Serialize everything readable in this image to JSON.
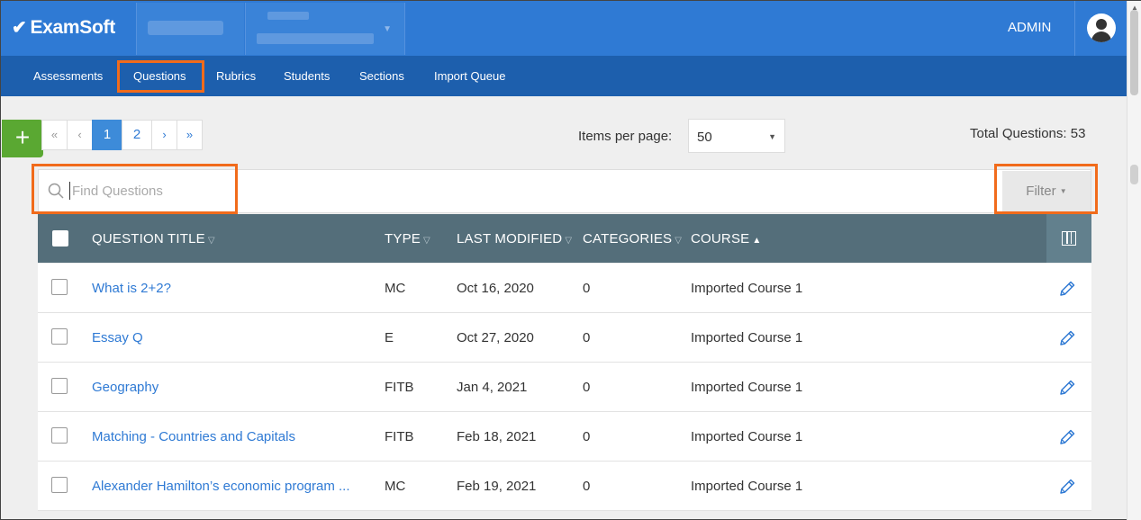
{
  "header": {
    "logo_text": "ExamSoft",
    "admin_label": "ADMIN"
  },
  "nav": {
    "items": [
      "Assessments",
      "Questions",
      "Rubrics",
      "Students",
      "Sections",
      "Import Queue"
    ],
    "active": "Questions"
  },
  "toolbar": {
    "add_label": "+",
    "pagination": {
      "first": "«",
      "prev": "‹",
      "pages": [
        "1",
        "2"
      ],
      "current": "1",
      "next": "›",
      "last": "»"
    },
    "items_per_page_label": "Items per page:",
    "items_per_page_value": "50",
    "total_label": "Total Questions: 53"
  },
  "search": {
    "placeholder": "Find Questions",
    "filter_label": "Filter"
  },
  "table": {
    "columns": [
      "QUESTION TITLE",
      "TYPE",
      "LAST MODIFIED",
      "CATEGORIES",
      "COURSE"
    ],
    "sort_column": "COURSE",
    "sort_direction": "ascending",
    "rows": [
      {
        "title": "What is 2+2?",
        "type": "MC",
        "modified": "Oct 16, 2020",
        "categories": "0",
        "course": "Imported Course 1"
      },
      {
        "title": "Essay Q",
        "type": "E",
        "modified": "Oct 27, 2020",
        "categories": "0",
        "course": "Imported Course 1"
      },
      {
        "title": "Geography",
        "type": "FITB",
        "modified": "Jan 4, 2021",
        "categories": "0",
        "course": "Imported Course 1"
      },
      {
        "title": "Matching - Countries and Capitals",
        "type": "FITB",
        "modified": "Feb 18, 2021",
        "categories": "0",
        "course": "Imported Course 1"
      },
      {
        "title": "Alexander Hamilton’s economic program ...",
        "type": "MC",
        "modified": "Feb 19, 2021",
        "categories": "0",
        "course": "Imported Course 1"
      }
    ]
  },
  "colors": {
    "topbar": "#2f7ad4",
    "navbar": "#1d5fad",
    "highlight": "#f16b1b",
    "table_header": "#546e7a",
    "add_button": "#5aa832",
    "link": "#2f7ad4"
  }
}
